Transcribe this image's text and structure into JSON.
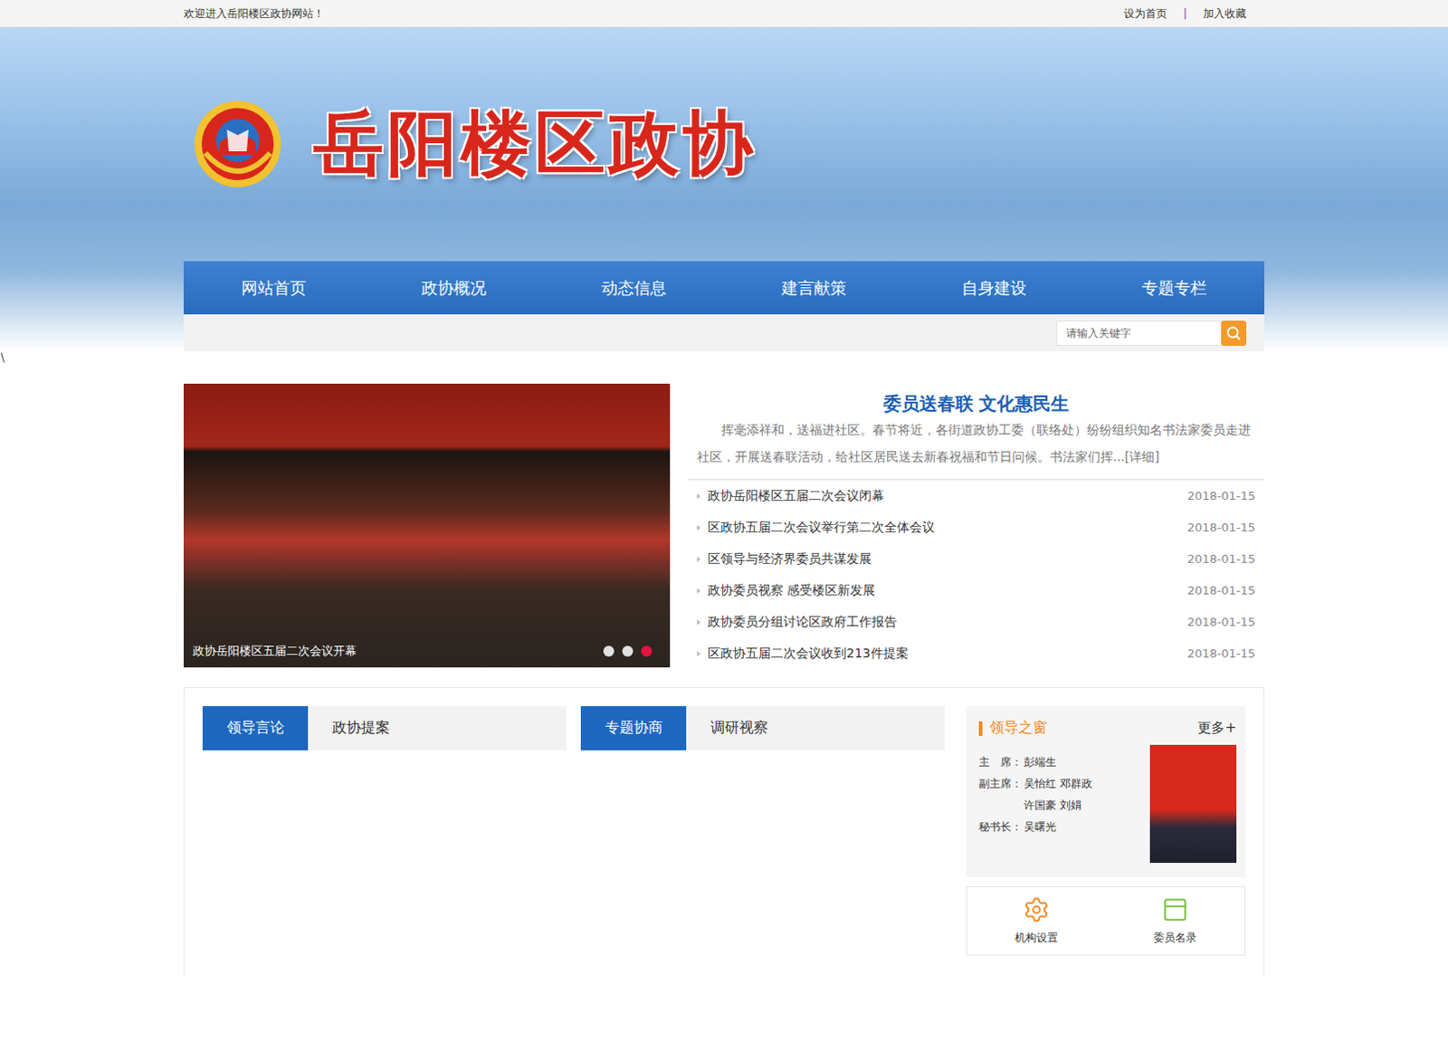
{
  "topbar": {
    "welcome": "欢迎进入岳阳楼区政协网站！",
    "links": [
      "设为首页",
      "加入收藏"
    ],
    "separator": "|"
  },
  "banner": {
    "title": "岳阳楼区政协"
  },
  "nav": [
    "网站首页",
    "政协概况",
    "动态信息",
    "建言献策",
    "自身建设",
    "专题专栏"
  ],
  "search": {
    "placeholder": "请输入关键字"
  },
  "stray_text": "\\",
  "slider": {
    "caption": "政协岳阳楼区五届二次会议开幕",
    "dots": [
      {
        "selected": false
      },
      {
        "selected": false
      },
      {
        "selected": true
      }
    ]
  },
  "headline": {
    "title": "委员送春联 文化惠民生",
    "summary": "挥毫添祥和，送福进社区。春节将近，各街道政协工委（联络处）纷纷组织知名书法家委员走进社区，开展送春联活动，给社区居民送去新春祝福和节日问候。书法家们挥...",
    "more": "[详细]"
  },
  "news": [
    {
      "title": "政协岳阳楼区五届二次会议闭幕",
      "date": "2018-01-15"
    },
    {
      "title": "区政协五届二次会议举行第二次全体会议",
      "date": "2018-01-15"
    },
    {
      "title": "区领导与经济界委员共谋发展",
      "date": "2018-01-15"
    },
    {
      "title": "政协委员视察 感受楼区新发展",
      "date": "2018-01-15"
    },
    {
      "title": "政协委员分组讨论区政府工作报告",
      "date": "2018-01-15"
    },
    {
      "title": "区政协五届二次会议收到213件提案",
      "date": "2018-01-15"
    }
  ],
  "tab_groups": [
    {
      "tabs": [
        {
          "label": "领导言论",
          "selected": true
        },
        {
          "label": "政协提案",
          "selected": false
        }
      ]
    },
    {
      "tabs": [
        {
          "label": "专题协商",
          "selected": true
        },
        {
          "label": "调研视察",
          "selected": false
        }
      ]
    }
  ],
  "leaders": {
    "title": "领导之窗",
    "more": "更多+",
    "rows": [
      {
        "label": "主　席：",
        "names": [
          "彭端生"
        ]
      },
      {
        "label": "副主席：",
        "names": [
          "吴怡红 邓群政",
          "许国豪 刘娟"
        ]
      },
      {
        "label": "秘书长：",
        "names": [
          "吴曙光"
        ]
      }
    ]
  },
  "quick_links": [
    {
      "label": "机构设置",
      "kind": "gear",
      "color": "#f08a24"
    },
    {
      "label": "委员名录",
      "kind": "window",
      "color": "#7cc242"
    }
  ]
}
